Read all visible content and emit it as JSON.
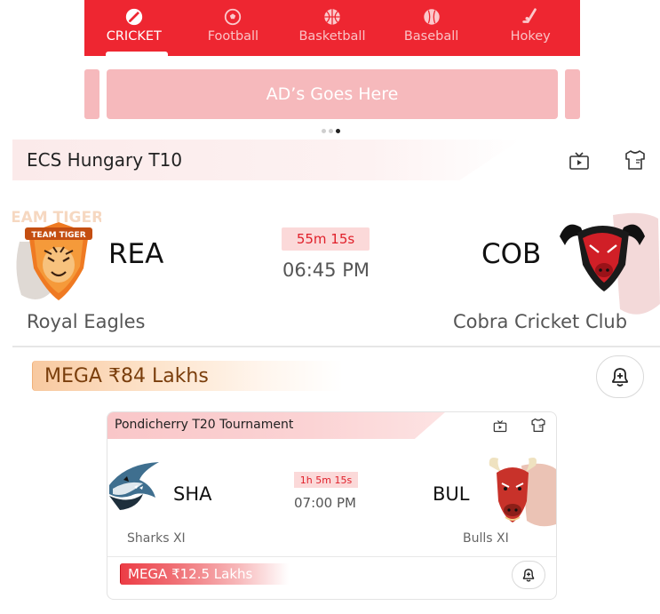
{
  "sports_tabs": [
    {
      "label": "CRICKET",
      "icon": "cricket-bat-icon",
      "active": true
    },
    {
      "label": "Football",
      "icon": "football-icon",
      "active": false
    },
    {
      "label": "Basketball",
      "icon": "basketball-icon",
      "active": false
    },
    {
      "label": "Baseball",
      "icon": "baseball-icon",
      "active": false
    },
    {
      "label": "Hokey",
      "icon": "hockey-stick-icon",
      "active": false
    }
  ],
  "ad": {
    "text": "AD’s Goes Here",
    "dots": 3,
    "active_dot": 3
  },
  "featured_match": {
    "league": "ECS Hungary T10",
    "team_left": {
      "abbr": "REA",
      "name": "Royal Eagles",
      "logo_text": "TEAM TIGER"
    },
    "team_right": {
      "abbr": "COB",
      "name": "Cobra Cricket Club"
    },
    "countdown": "55m 15s",
    "start_time": "06:45 PM",
    "prize": "MEGA ₹84 Lakhs"
  },
  "secondary_match": {
    "league": "Pondicherry T20 Tournament",
    "team_left": {
      "abbr": "SHA",
      "name": "Sharks XI"
    },
    "team_right": {
      "abbr": "BUL",
      "name": "Bulls XI"
    },
    "countdown": "1h 5m 15s",
    "start_time": "07:00 PM",
    "prize": "MEGA ₹12.5 Lakhs"
  },
  "colors": {
    "brand_red": "#ee2631",
    "ad_pink": "#f6b9bc",
    "timer_bg": "#fbd9d9",
    "mega_brown": "#7a3e0c"
  }
}
